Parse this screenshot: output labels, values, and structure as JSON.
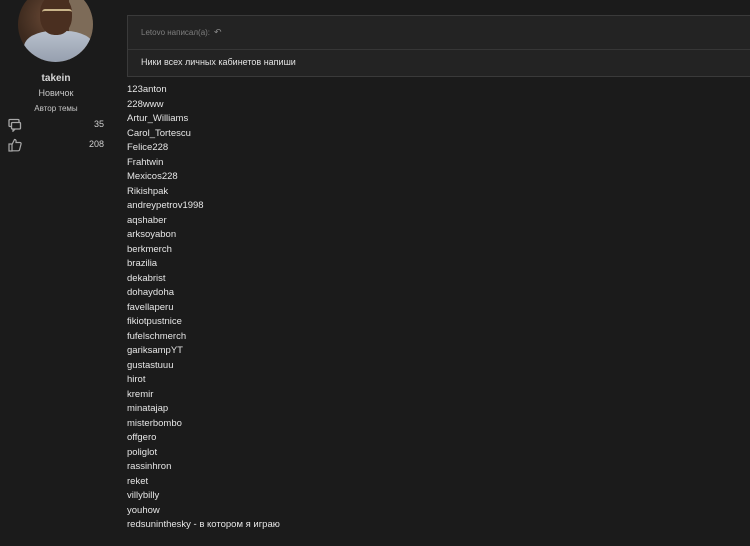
{
  "author": {
    "username": "takein",
    "rank": "Новичок",
    "role": "Автор темы",
    "messages_icon": "messages-icon",
    "messages_count": "35",
    "likes_icon": "thumbs-up-icon",
    "likes_count": "208"
  },
  "quote": {
    "header": "Letovo написал(а):",
    "jump_icon": "reply-arrow-icon",
    "body": "Ники всех личных кабинетов напиши"
  },
  "nicknames": [
    "123anton",
    "228www",
    "Artur_Williams",
    "Carol_Tortescu",
    "Felice228",
    "Frahtwin",
    "Mexicos228",
    "Rikishpak",
    "andreypetrov1998",
    "aqshaber",
    "arksoyabon",
    "berkmerch",
    "brazilia",
    "dekabrist",
    "dohaydoha",
    "favellaperu",
    "fikiotpustnice",
    "fufelschmerch",
    "gariksampYT",
    "gustastuuu",
    "hirot",
    "kremir",
    "minatajap",
    "misterbombo",
    "offgero",
    "poliglot",
    "rassinhron",
    "reket",
    "villybilly",
    "youhow",
    "redsuninthesky - в котором я играю"
  ]
}
